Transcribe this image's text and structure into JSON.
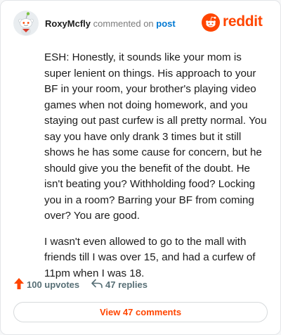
{
  "header": {
    "username": "RoxyMcfly",
    "action_text": "commented on",
    "link_text": "post",
    "brand": "reddit"
  },
  "comment": {
    "paragraphs": [
      "ESH: Honestly, it sounds like your mom is super lenient on things. His approach to your BF in your room, your brother's playing video games when not doing homework, and you staying out past curfew is all pretty normal. You say you have only drank 3 times but it still shows he has some cause for concern, but he should give you the benefit of the doubt. He isn't beating you? Withholding food? Locking you in a room? Barring your BF from coming over? You are good.",
      "I wasn't even allowed to go to the mall with friends till I was over 15, and had a curfew of 11pm when I was 18."
    ]
  },
  "stats": {
    "upvotes": "100 upvotes",
    "replies": "47 replies"
  },
  "footer": {
    "view_comments": "View 47 comments"
  },
  "colors": {
    "brand": "#ff4500",
    "link": "#0079d3",
    "muted": "#576f76"
  },
  "icons": {
    "avatar": "snoo-avatar-icon",
    "logo": "reddit-logo-icon",
    "upvote": "upvote-arrow-icon",
    "reply": "reply-arrow-icon"
  }
}
